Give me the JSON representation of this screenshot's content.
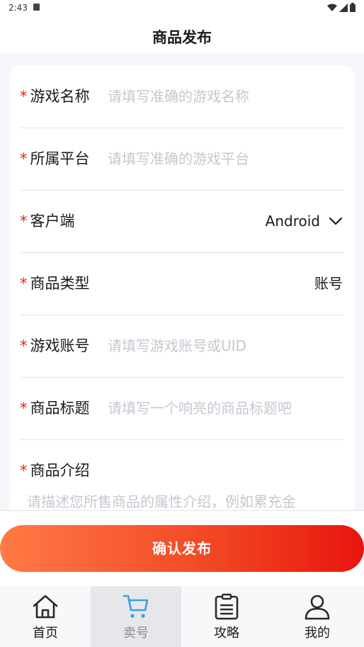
{
  "status_bar": {
    "time": "2:43"
  },
  "header": {
    "title": "商品发布"
  },
  "form": {
    "required_mark": "*",
    "game_name": {
      "label": "游戏名称",
      "placeholder": "请填写准确的游戏名称"
    },
    "platform": {
      "label": "所属平台",
      "placeholder": "请填写准确的游戏平台"
    },
    "client": {
      "label": "客户端",
      "value": "Android",
      "icon": "chevron-down-icon"
    },
    "product_type": {
      "label": "商品类型",
      "value": "账号"
    },
    "game_account": {
      "label": "游戏账号",
      "placeholder": "请填写游戏账号或UID"
    },
    "product_title": {
      "label": "商品标题",
      "placeholder": "请填写一个响亮的商品标题吧"
    },
    "description": {
      "label": "商品介绍",
      "placeholder": "请描述您所售商品的属性介绍，例如累充金"
    }
  },
  "submit": {
    "label": "确认发布"
  },
  "tabbar": {
    "items": [
      {
        "label": "首页",
        "icon": "home-icon",
        "active": false
      },
      {
        "label": "卖号",
        "icon": "cart-icon",
        "active": true
      },
      {
        "label": "攻略",
        "icon": "clipboard-icon",
        "active": false
      },
      {
        "label": "我的",
        "icon": "user-icon",
        "active": false
      }
    ]
  },
  "colors": {
    "accent_start": "#ff7a45",
    "accent_end": "#e8150d",
    "required": "#e8231e",
    "placeholder": "#c4c8cf"
  }
}
